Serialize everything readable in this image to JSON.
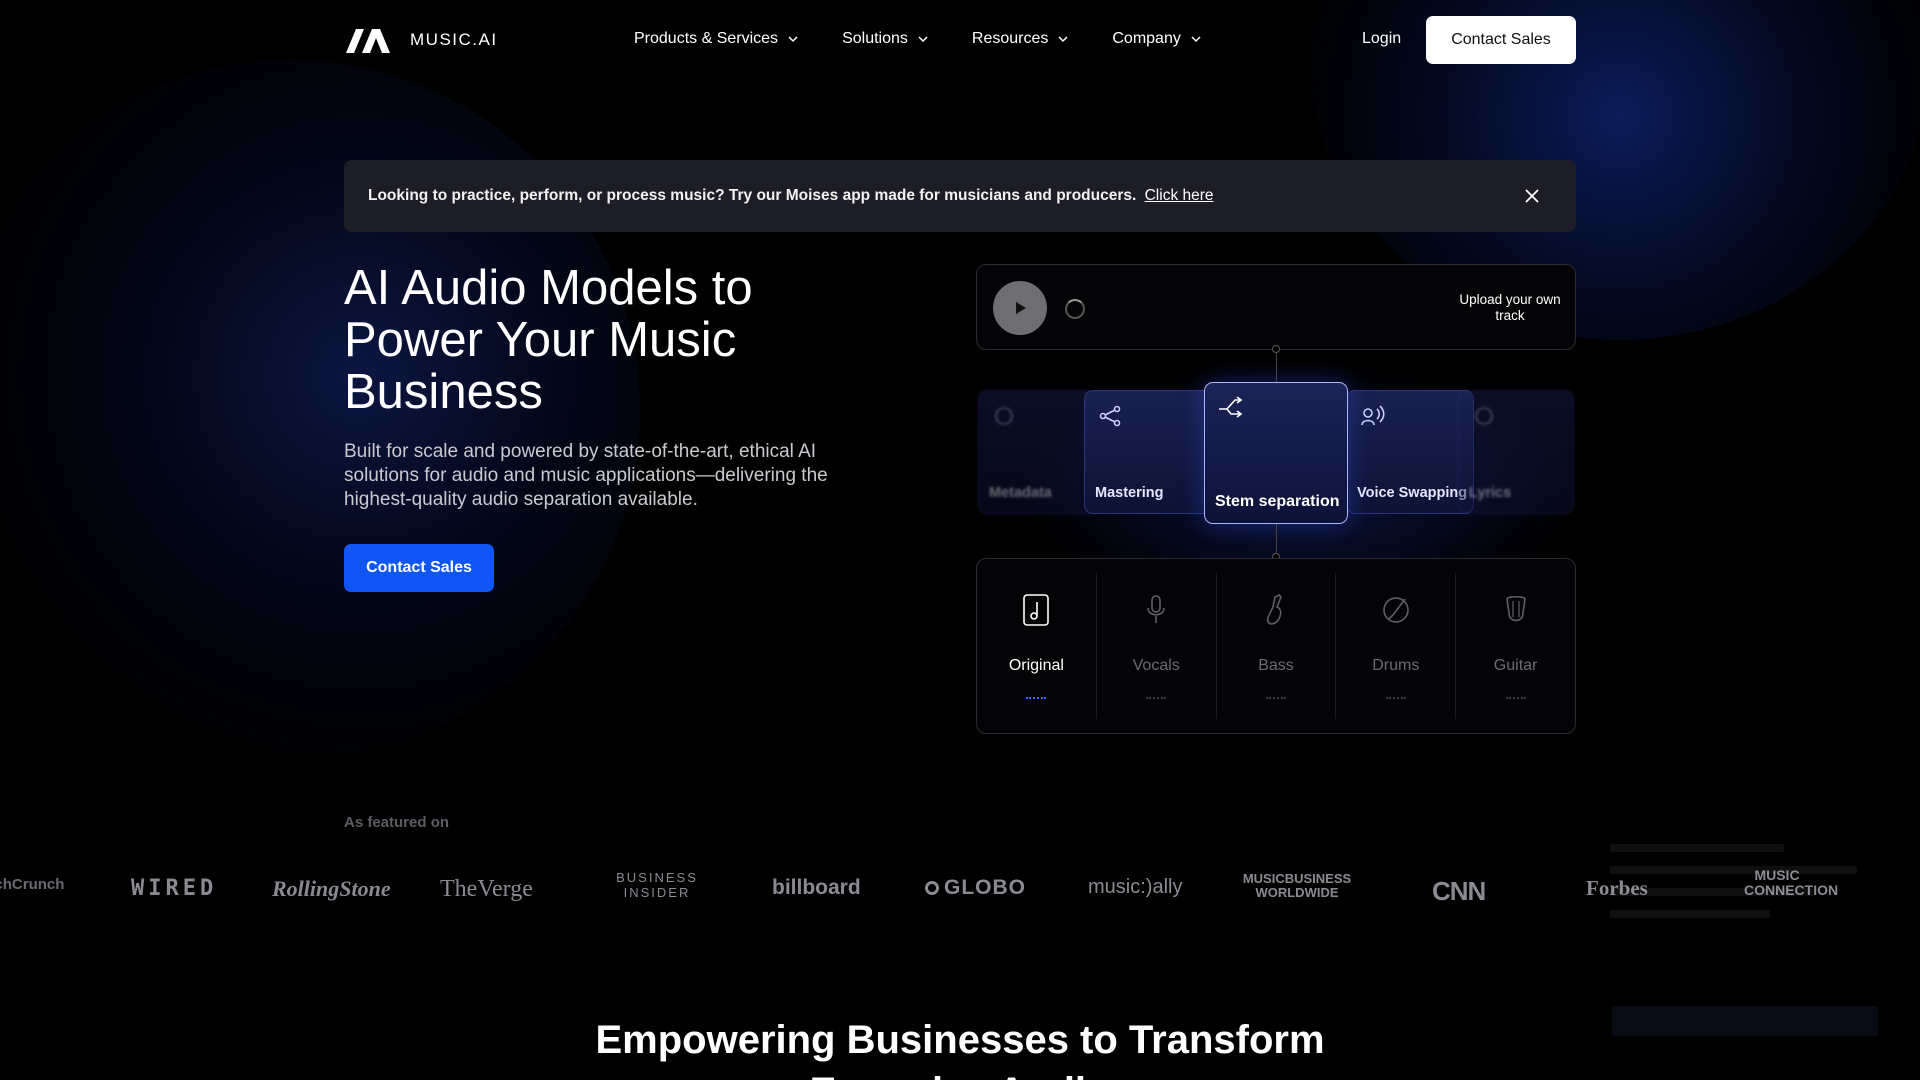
{
  "nav": {
    "logo_text": "MUSIC.AI",
    "menu": [
      {
        "label": "Products & Services"
      },
      {
        "label": "Solutions"
      },
      {
        "label": "Resources"
      },
      {
        "label": "Company"
      }
    ],
    "login": "Login",
    "contact_sales": "Contact Sales"
  },
  "banner": {
    "text": "Looking to practice, perform, or process music? Try our Moises app made for musicians and producers.",
    "link": "Click here"
  },
  "hero": {
    "title": "AI Audio Models to Power Your Music Business",
    "subtitle": "Built for scale and powered by state-of-the-art, ethical AI solutions for audio and music applications—delivering the highest-quality audio separation available.",
    "cta": "Contact Sales"
  },
  "player": {
    "upload_label": "Upload your own track"
  },
  "carousel": {
    "cards": [
      {
        "label": "Metadata",
        "icon": "tag-icon",
        "state": "faded"
      },
      {
        "label": "Mastering",
        "icon": "share-nodes-icon",
        "state": "normal"
      },
      {
        "label": "Stem separation",
        "icon": "split-arrows-icon",
        "state": "active"
      },
      {
        "label": "Voice Swapping",
        "icon": "voice-icon",
        "state": "normal"
      },
      {
        "label": "Lyrics",
        "icon": "lyrics-icon",
        "state": "faded"
      }
    ]
  },
  "stems": [
    {
      "label": "Original",
      "icon": "music-file-icon",
      "active": true
    },
    {
      "label": "Vocals",
      "icon": "microphone-icon",
      "active": false
    },
    {
      "label": "Bass",
      "icon": "bass-icon",
      "active": false
    },
    {
      "label": "Drums",
      "icon": "drum-icon",
      "active": false
    },
    {
      "label": "Guitar",
      "icon": "guitar-icon",
      "active": false
    }
  ],
  "featured": {
    "label": "As featured on",
    "logos": [
      "TechCrunch",
      "WIRED",
      "RollingStone",
      "TheVerge",
      "BUSINESS INSIDER",
      "billboard",
      "GLOBO",
      "music:)ally",
      "MUSICBUSINESS WORLDWIDE",
      "CNN",
      "Forbes",
      "MUSIC CONNECTION"
    ]
  },
  "bottom": {
    "title": "Empowering Businesses to Transform Everyday Audio"
  },
  "colors": {
    "accent": "#0f56f5",
    "banner_bg": "#1c1d27",
    "card_border_active": "#a8b3ff"
  }
}
